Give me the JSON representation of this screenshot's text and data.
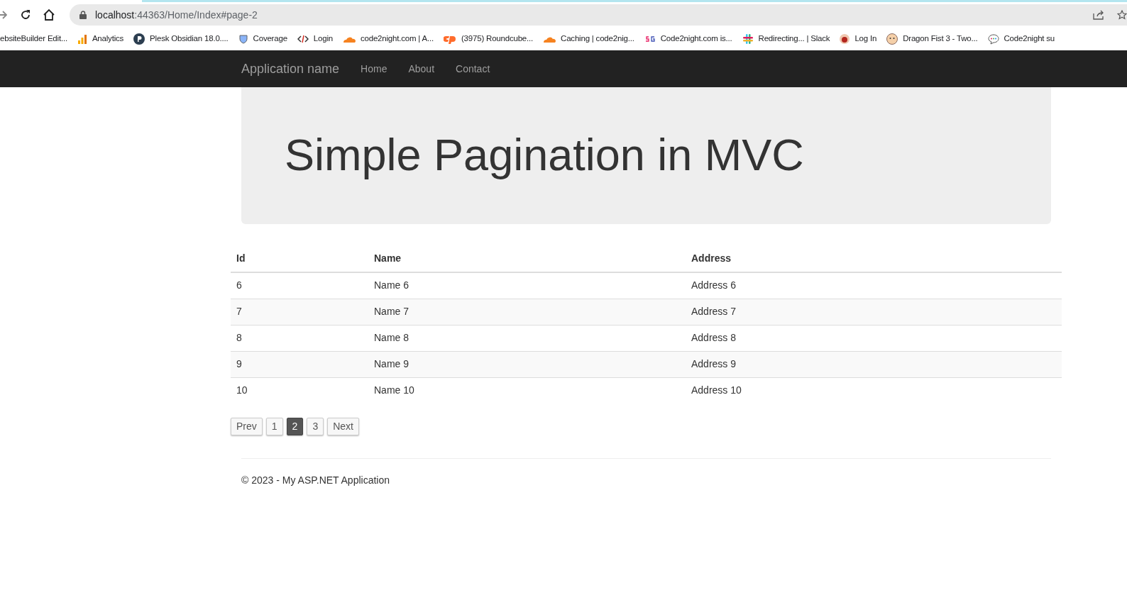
{
  "browser": {
    "url_host": "localhost",
    "url_path": ":44363/Home/Index#page-2"
  },
  "bookmarks": [
    {
      "label": "ebsiteBuilder Edit...",
      "kind": "none"
    },
    {
      "label": "Analytics",
      "kind": "bars"
    },
    {
      "label": "Plesk Obsidian 18.0....",
      "kind": "circle"
    },
    {
      "label": "Coverage",
      "kind": "shield"
    },
    {
      "label": "Login",
      "kind": "code"
    },
    {
      "label": "code2night.com | A...",
      "kind": "cloud"
    },
    {
      "label": "(3975) Roundcube...",
      "kind": "cp"
    },
    {
      "label": "Caching | code2nig...",
      "kind": "cloud"
    },
    {
      "label": "Code2night.com is...",
      "kind": "sg"
    },
    {
      "label": "Redirecting... | Slack",
      "kind": "hash"
    },
    {
      "label": "Log In",
      "kind": "dot"
    },
    {
      "label": "Dragon Fist 3 - Two...",
      "kind": "face"
    },
    {
      "label": "Code2night su",
      "kind": "chat"
    }
  ],
  "navbar": {
    "brand": "Application name",
    "links": [
      "Home",
      "About",
      "Contact"
    ]
  },
  "jumbotron": {
    "title": "Simple Pagination in MVC"
  },
  "table": {
    "columns": [
      "Id",
      "Name",
      "Address"
    ],
    "rows": [
      [
        "6",
        "Name 6",
        "Address 6"
      ],
      [
        "7",
        "Name 7",
        "Address 7"
      ],
      [
        "8",
        "Name 8",
        "Address 8"
      ],
      [
        "9",
        "Name 9",
        "Address 9"
      ],
      [
        "10",
        "Name 10",
        "Address 10"
      ]
    ]
  },
  "pagination": [
    {
      "label": "Prev",
      "selected": false
    },
    {
      "label": "1",
      "selected": false
    },
    {
      "label": "2",
      "selected": true
    },
    {
      "label": "3",
      "selected": false
    },
    {
      "label": "Next",
      "selected": false
    }
  ],
  "footer": "© 2023 - My ASP.NET Application"
}
